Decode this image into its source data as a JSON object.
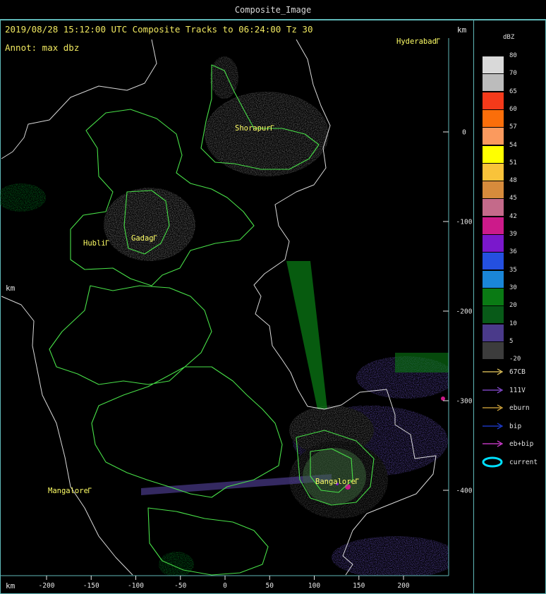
{
  "window": {
    "title": "Composite_Image"
  },
  "header": {
    "line1": "2019/08/28 15:12:00 UTC Composite Tracks to 06:24:00 Tz 30",
    "line2": "Annot: max dbz",
    "units": "km"
  },
  "axes": {
    "x_unit": "km",
    "y_unit_top": "km",
    "y_unit_left": "km",
    "x_ticks": [
      "-200",
      "-150",
      "-100",
      "-50",
      "0",
      "50",
      "100",
      "150",
      "200"
    ],
    "y_ticks": [
      "0",
      "-100",
      "-200",
      "-300",
      "-400"
    ]
  },
  "cities": [
    {
      "name": "Hyderabad"
    },
    {
      "name": "Shorapur"
    },
    {
      "name": "Gadag"
    },
    {
      "name": "Hubli"
    },
    {
      "name": "Mangalore"
    },
    {
      "name": "Bangalore"
    }
  ],
  "legend": {
    "title": "dBZ",
    "levels": [
      {
        "label": "80",
        "color": "#d9d9d9"
      },
      {
        "label": "70",
        "color": "#bcbcbc"
      },
      {
        "label": "65",
        "color": "#f43a1a"
      },
      {
        "label": "60",
        "color": "#fb6e0a"
      },
      {
        "label": "57",
        "color": "#fb9a5e"
      },
      {
        "label": "54",
        "color": "#ffff00"
      },
      {
        "label": "51",
        "color": "#f9c33a"
      },
      {
        "label": "48",
        "color": "#d68b3c"
      },
      {
        "label": "45",
        "color": "#c46a8a"
      },
      {
        "label": "42",
        "color": "#cc1a8a"
      },
      {
        "label": "39",
        "color": "#7a18cc"
      },
      {
        "label": "36",
        "color": "#2450e0"
      },
      {
        "label": "35",
        "color": "#1a86d8"
      },
      {
        "label": "30",
        "color": "#0a7a14"
      },
      {
        "label": "20",
        "color": "#085a18"
      },
      {
        "label": "10",
        "color": "#4a3a8a"
      },
      {
        "label": "5",
        "color": "#3c3c3c"
      },
      {
        "label": "-20",
        "color": ""
      }
    ]
  },
  "tracks": [
    {
      "label": "67CB",
      "color": "#f0d060"
    },
    {
      "label": "111V",
      "color": "#9050e0"
    },
    {
      "label": "eburn",
      "color": "#e0b040"
    },
    {
      "label": "bip",
      "color": "#2040e0"
    },
    {
      "label": "eb+bip",
      "color": "#e040e0"
    },
    {
      "label": "current",
      "color": "#00e0ff"
    }
  ]
}
